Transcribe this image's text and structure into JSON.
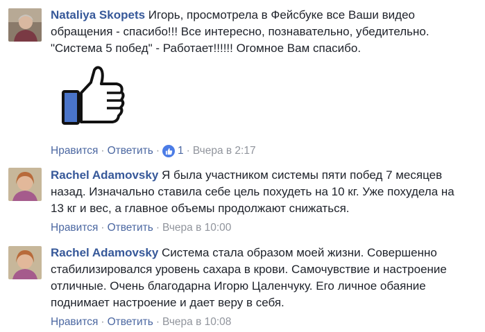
{
  "comments": [
    {
      "author": "Nataliya Skopets",
      "text": "Игорь, просмотрела в Фейсбуке все Ваши видео\nобращения - спасибо!!! Все интересно, познавательно, убедительно.\n\"Система 5 побед\" - Работает!!!!!! Огомное Вам спасибо.",
      "like_label": "Нравится",
      "reply_label": "Ответить",
      "separator": "·",
      "reaction_count": "1",
      "time": "Вчера в 2:17"
    },
    {
      "author": "Rachel Adamovsky",
      "text": "Я была участником системы пяти побед 7 месяцев\nназад. Изначально ставила себе цель похудеть на 10 кг. Уже похудела на\n13 кг и вес, а главное объемы продолжают снижаться.",
      "like_label": "Нравится",
      "reply_label": "Ответить",
      "separator": "·",
      "time": "Вчера в 10:00"
    },
    {
      "author": "Rachel Adamovsky",
      "text": "Система стала образом моей жизни. Совершенно\nстабилизировался уровень сахара в крови. Самочувствие и настроение\nотличные. Очень благодарна Игорю Цаленчуку. Его личное обаяние\nподнимает настроение и дает веру в себя.",
      "like_label": "Нравится",
      "reply_label": "Ответить",
      "separator": "·",
      "time": "Вчера в 10:08"
    }
  ],
  "colors": {
    "author": "#365899",
    "link": "#4b67a1",
    "meta": "#90949c",
    "text": "#1d2129",
    "thumb_blue": "#4a74c9"
  },
  "icons": [
    "avatar-photo",
    "thumbs-up-sticker",
    "like-reaction-icon"
  ]
}
